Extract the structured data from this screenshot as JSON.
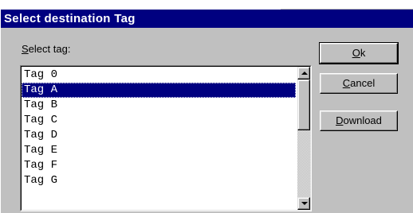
{
  "dialog": {
    "title": "Select destination Tag",
    "label_prefix": "S",
    "label_rest": "elect tag:"
  },
  "list": {
    "items": [
      "Tag 0",
      "Tag A",
      "Tag B",
      "Tag C",
      "Tag D",
      "Tag E",
      "Tag F",
      "Tag G"
    ],
    "selected_index": 1
  },
  "buttons": {
    "ok_mnemonic": "O",
    "ok_rest": "k",
    "cancel_mnemonic": "C",
    "cancel_rest": "ancel",
    "download_mnemonic": "D",
    "download_rest": "ownload"
  },
  "colors": {
    "titlebar": "#000080",
    "face": "#c0c0c0",
    "selection": "#000080"
  },
  "icons": {
    "scroll_up": "arrow-up-icon",
    "scroll_down": "arrow-down-icon"
  }
}
